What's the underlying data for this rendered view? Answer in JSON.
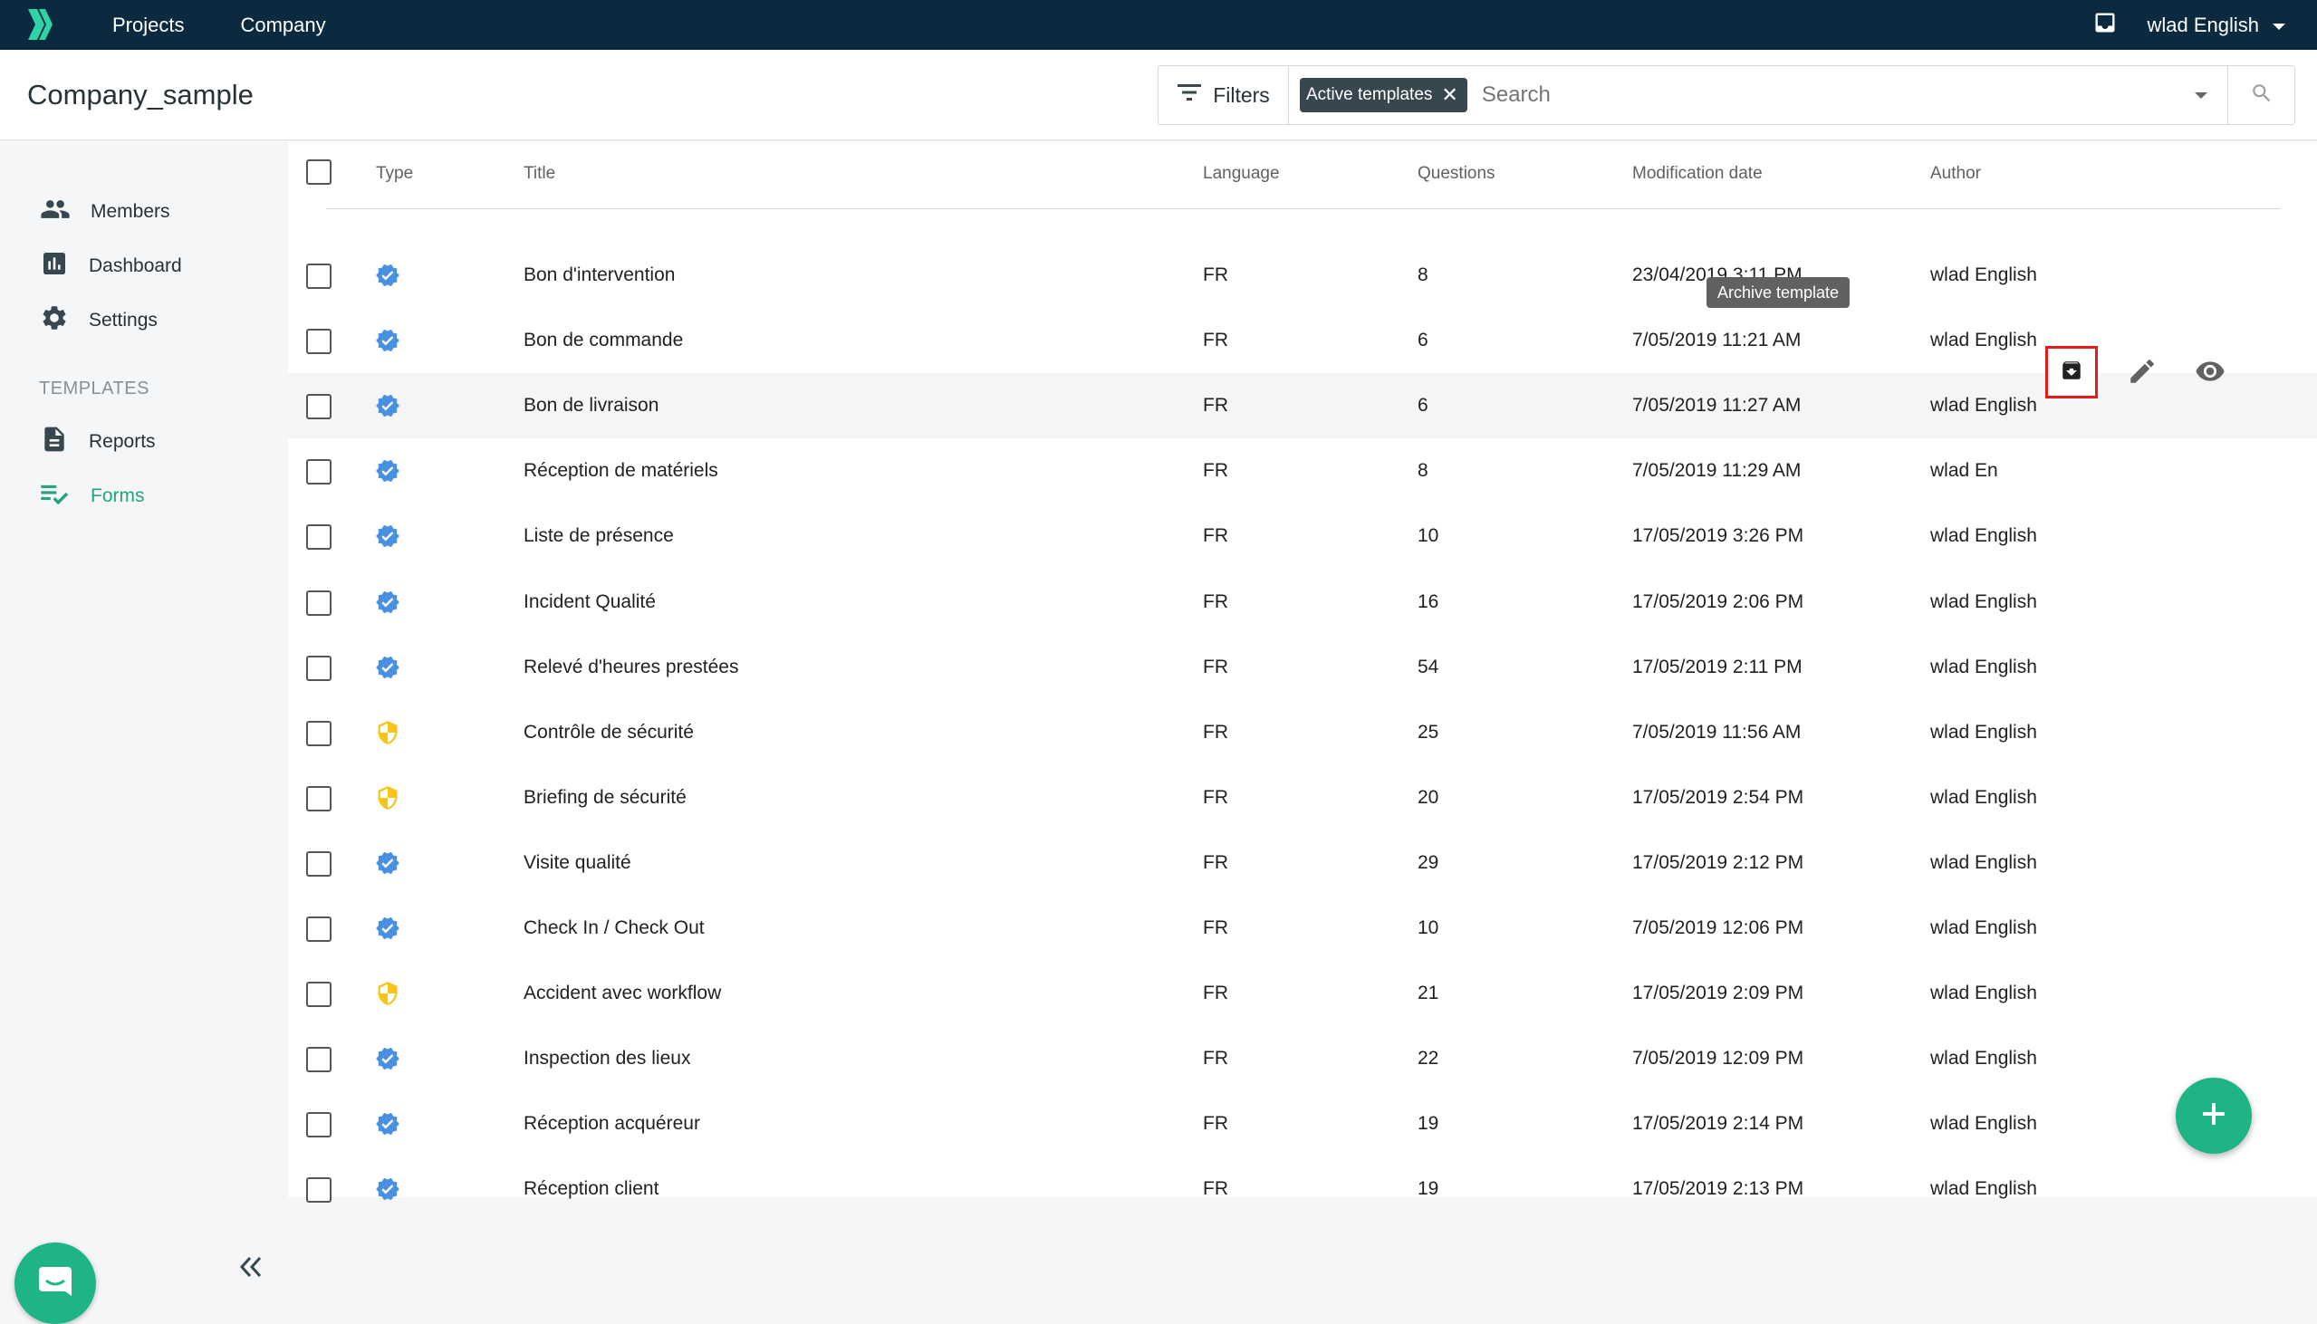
{
  "topbar": {
    "nav": [
      "Projects",
      "Company"
    ],
    "user_name": "wlad English"
  },
  "header": {
    "title": "Company_sample",
    "filters_label": "Filters",
    "active_chip": "Active templates",
    "search_placeholder": "Search"
  },
  "sidebar": {
    "items": [
      {
        "label": "Members",
        "icon": "members-icon"
      },
      {
        "label": "Dashboard",
        "icon": "dashboard-icon"
      },
      {
        "label": "Settings",
        "icon": "settings-icon"
      }
    ],
    "section_label": "TEMPLATES",
    "template_items": [
      {
        "label": "Reports",
        "icon": "reports-icon"
      },
      {
        "label": "Forms",
        "icon": "forms-icon",
        "active": true
      }
    ]
  },
  "table": {
    "columns": [
      "Type",
      "Title",
      "Language",
      "Questions",
      "Modification date",
      "Author"
    ],
    "rows": [
      {
        "type": "verified",
        "title": "Bon d'intervention",
        "language": "FR",
        "questions": "8",
        "date": "23/04/2019 3:11 PM",
        "author": "wlad English"
      },
      {
        "type": "verified",
        "title": "Bon de commande",
        "language": "FR",
        "questions": "6",
        "date": "7/05/2019 11:21 AM",
        "author": "wlad English"
      },
      {
        "type": "verified",
        "title": "Bon de livraison",
        "language": "FR",
        "questions": "6",
        "date": "7/05/2019 11:27 AM",
        "author": "wlad English"
      },
      {
        "type": "verified",
        "title": "Réception de matériels",
        "language": "FR",
        "questions": "8",
        "date": "7/05/2019 11:29 AM",
        "author": "wlad En"
      },
      {
        "type": "verified",
        "title": "Liste de présence",
        "language": "FR",
        "questions": "10",
        "date": "17/05/2019 3:26 PM",
        "author": "wlad English"
      },
      {
        "type": "verified",
        "title": "Incident Qualité",
        "language": "FR",
        "questions": "16",
        "date": "17/05/2019 2:06 PM",
        "author": "wlad English"
      },
      {
        "type": "verified",
        "title": "Relevé d'heures prestées",
        "language": "FR",
        "questions": "54",
        "date": "17/05/2019 2:11 PM",
        "author": "wlad English"
      },
      {
        "type": "safety",
        "title": "Contrôle de sécurité",
        "language": "FR",
        "questions": "25",
        "date": "7/05/2019 11:56 AM",
        "author": "wlad English"
      },
      {
        "type": "safety",
        "title": "Briefing de sécurité",
        "language": "FR",
        "questions": "20",
        "date": "17/05/2019 2:54 PM",
        "author": "wlad English"
      },
      {
        "type": "verified",
        "title": "Visite qualité",
        "language": "FR",
        "questions": "29",
        "date": "17/05/2019 2:12 PM",
        "author": "wlad English"
      },
      {
        "type": "verified",
        "title": "Check In / Check Out",
        "language": "FR",
        "questions": "10",
        "date": "7/05/2019 12:06 PM",
        "author": "wlad English"
      },
      {
        "type": "safety",
        "title": "Accident avec workflow",
        "language": "FR",
        "questions": "21",
        "date": "17/05/2019 2:09 PM",
        "author": "wlad English"
      },
      {
        "type": "verified",
        "title": "Inspection des lieux",
        "language": "FR",
        "questions": "22",
        "date": "7/05/2019 12:09 PM",
        "author": "wlad English"
      },
      {
        "type": "verified",
        "title": "Réception acquéreur",
        "language": "FR",
        "questions": "19",
        "date": "17/05/2019 2:14 PM",
        "author": "wlad English"
      },
      {
        "type": "verified",
        "title": "Réception client",
        "language": "FR",
        "questions": "19",
        "date": "17/05/2019 2:13 PM",
        "author": "wlad English"
      }
    ],
    "hover_row_index": 2,
    "tooltip": "Archive template"
  },
  "colors": {
    "topbar": "#0b2a40",
    "accent": "#1fb486",
    "verified_icon": "#4a90e2",
    "safety_icon": "#f5c518",
    "highlight_border": "#e21b1b"
  }
}
